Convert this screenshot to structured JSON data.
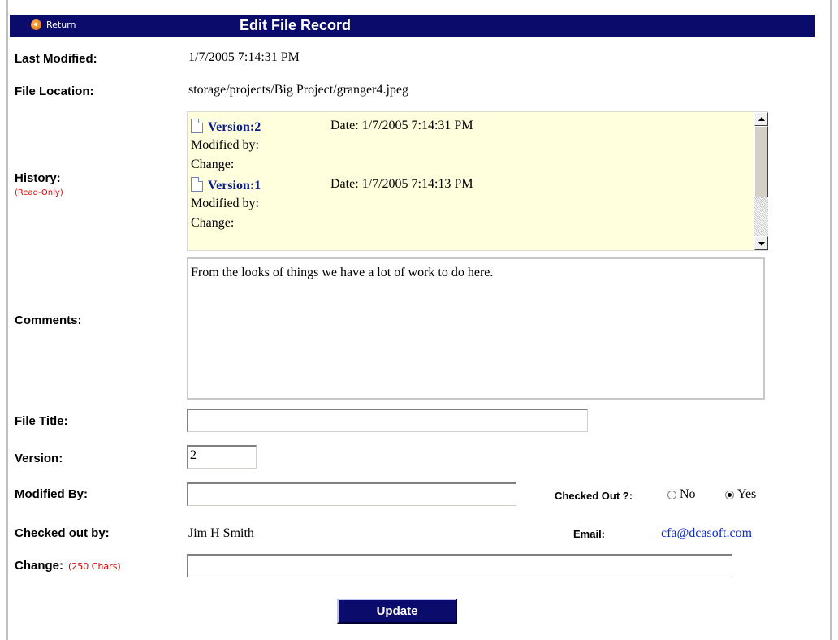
{
  "header": {
    "return_label": "Return",
    "title": "Edit File Record"
  },
  "fields": {
    "last_modified_label": "Last Modified:",
    "last_modified_value": "1/7/2005 7:14:31 PM",
    "file_location_label": "File Location:",
    "file_location_value": "storage/projects/Big Project/granger4.jpeg",
    "history_label": "History:",
    "history_note": "(Read-Only)",
    "comments_label": "Comments:",
    "comments_value": "From the looks of things we have a lot of work to do here.",
    "file_title_label": "File Title:",
    "file_title_value": "",
    "version_label": "Version:",
    "version_value": "2",
    "modified_by_label": "Modified By:",
    "modified_by_value": "",
    "checked_out_label": "Checked Out ?:",
    "checked_out_options": [
      "No",
      "Yes"
    ],
    "checked_out_selected": "Yes",
    "checked_out_by_label": "Checked out by:",
    "checked_out_by_value": "Jim H Smith",
    "email_label": "Email:",
    "email_value": "cfa@dcasoft.com",
    "change_label": "Change:",
    "change_hint": "(250 Chars)",
    "change_value": ""
  },
  "history": [
    {
      "version": "Version:2",
      "date": "Date: 1/7/2005 7:14:31 PM",
      "modified_by": "Modified by:",
      "change": "Change:"
    },
    {
      "version": "Version:1",
      "date": "Date: 1/7/2005 7:14:13 PM",
      "modified_by": "Modified by:",
      "change": "Change:"
    }
  ],
  "actions": {
    "update_label": "Update"
  },
  "colors": {
    "header_bg": "#0b0b6b",
    "history_bg": "#ffffdd",
    "required_red": "#e00000",
    "link_blue": "#0b2ad0"
  }
}
